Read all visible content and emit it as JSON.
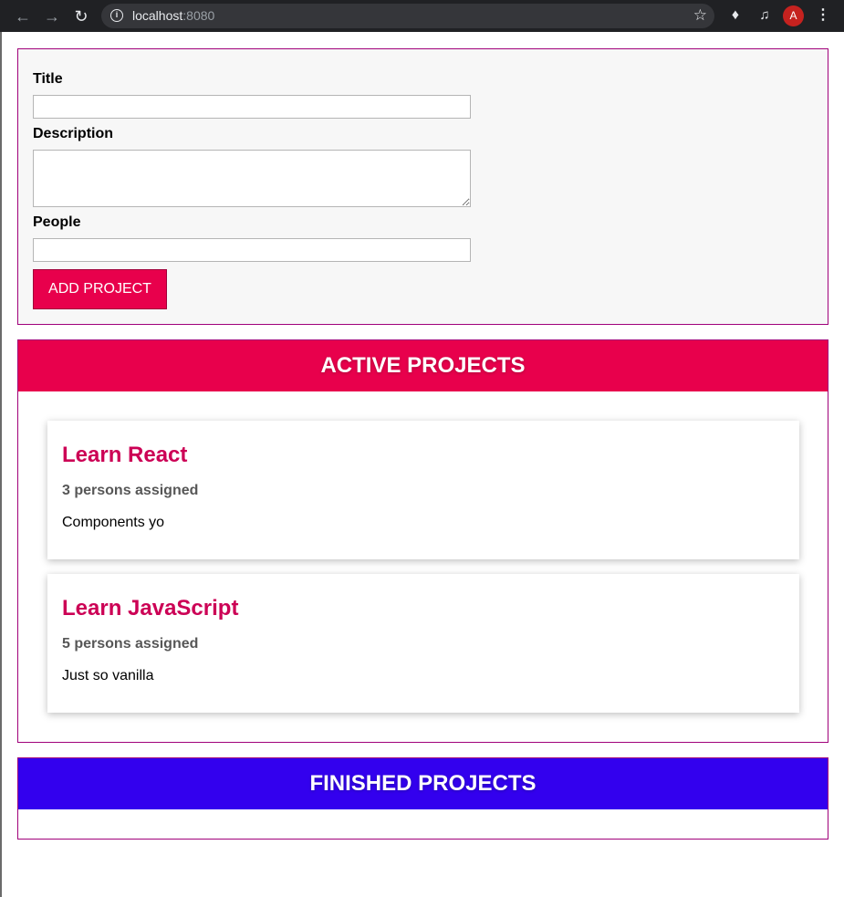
{
  "browser": {
    "url_host": "localhost",
    "url_port": ":8080",
    "avatar_initial": "A",
    "icons": [
      "back-icon",
      "forward-icon",
      "reload-icon",
      "info-icon",
      "star-icon",
      "extensions-icon",
      "media-icon",
      "menu-icon"
    ]
  },
  "form": {
    "title_label": "Title",
    "title_value": "",
    "description_label": "Description",
    "description_value": "",
    "people_label": "People",
    "people_value": "",
    "submit_label": "ADD PROJECT"
  },
  "active": {
    "header": "ACTIVE PROJECTS",
    "header_color": "#e8004c",
    "projects": [
      {
        "title": "Learn React",
        "assigned": "3 persons assigned",
        "description": "Components yo"
      },
      {
        "title": "Learn JavaScript",
        "assigned": "5 persons assigned",
        "description": "Just so vanilla"
      }
    ]
  },
  "finished": {
    "header": "FINISHED PROJECTS",
    "header_color": "#3300ee",
    "projects": []
  },
  "colors": {
    "accent": "#e8004c",
    "project_title": "#cc0055",
    "border": "#a0007a"
  }
}
